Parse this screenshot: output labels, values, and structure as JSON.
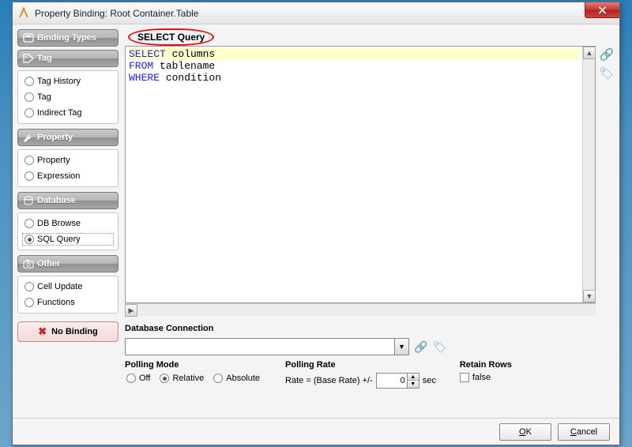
{
  "window": {
    "title": "Property Binding: Root Container.Table"
  },
  "sidebar": {
    "heading": "Binding Types",
    "groups": [
      {
        "title": "Tag",
        "icon": "tag-icon",
        "items": [
          {
            "label": "Tag History",
            "selected": false
          },
          {
            "label": "Tag",
            "selected": false
          },
          {
            "label": "Indirect Tag",
            "selected": false
          }
        ]
      },
      {
        "title": "Property",
        "icon": "wrench-icon",
        "items": [
          {
            "label": "Property",
            "selected": false
          },
          {
            "label": "Expression",
            "selected": false
          }
        ]
      },
      {
        "title": "Database",
        "icon": "database-icon",
        "items": [
          {
            "label": "DB Browse",
            "selected": false
          },
          {
            "label": "SQL Query",
            "selected": true
          }
        ]
      },
      {
        "title": "Other",
        "icon": "camera-icon",
        "items": [
          {
            "label": "Cell Update",
            "selected": false
          },
          {
            "label": "Functions",
            "selected": false
          }
        ]
      }
    ],
    "no_binding": "No Binding"
  },
  "main": {
    "section_title": "SELECT Query",
    "query": {
      "line1_kw": "SELECT",
      "line1_rest": " columns",
      "line2_kw": "FROM",
      "line2_rest": " tablename",
      "line3_kw": "WHERE",
      "line3_rest": " condition"
    },
    "side_icons": {
      "link": "link-icon",
      "tag": "tag-icon"
    },
    "db_conn_label": "Database Connection",
    "db_conn_value": "",
    "polling_mode_label": "Polling Mode",
    "polling_modes": [
      {
        "label": "Off",
        "selected": false
      },
      {
        "label": "Relative",
        "selected": true
      },
      {
        "label": "Absolute",
        "selected": false
      }
    ],
    "polling_rate_label": "Polling Rate",
    "polling_rate_prefix": "Rate = (Base Rate) +/-",
    "polling_rate_value": "0",
    "polling_rate_suffix": "sec",
    "retain_label": "Retain Rows",
    "retain_value": "false"
  },
  "footer": {
    "ok": "OK",
    "cancel": "Cancel"
  }
}
